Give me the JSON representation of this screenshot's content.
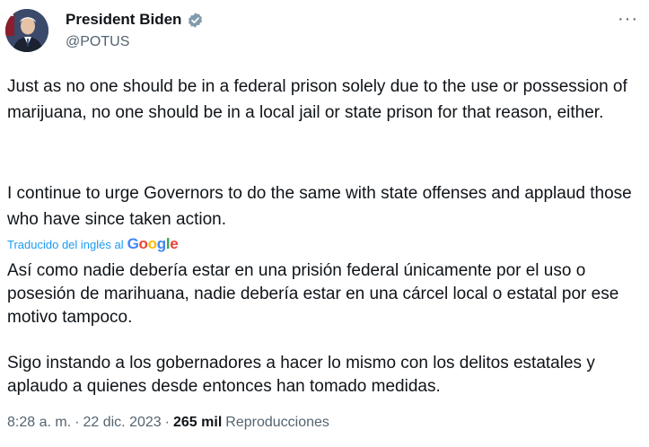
{
  "author": {
    "display_name": "President Biden",
    "handle": "@POTUS",
    "verified": true,
    "verified_color": "#829aab"
  },
  "menu": {
    "more_icon": "more-horizontal-icon",
    "label": "···"
  },
  "original": {
    "paragraph_1": "Just as no one should be in a federal prison solely due to the use or possession of marijuana, no one should be in a local jail or state prison for that reason, either.",
    "paragraph_2": "I continue to urge Governors to do the same with state offenses and applaud those who have since taken action."
  },
  "translation": {
    "label": "Traducido del inglés al",
    "provider": "Google",
    "paragraph_1": "Así como nadie debería estar en una prisión federal únicamente por el uso o posesión de marihuana, nadie debería estar en una cárcel local o estatal por ese motivo tampoco.",
    "paragraph_2": "Sigo instando a los gobernadores a hacer lo mismo con los delitos estatales y aplaudo a quienes desde entonces han tomado medidas."
  },
  "meta": {
    "time": "8:28 a. m.",
    "separator": "·",
    "date": "22 dic. 2023",
    "views_count": "265 mil",
    "views_label": "Reproducciones"
  },
  "colors": {
    "text": "#0f1419",
    "secondary": "#536471",
    "link": "#1d9bf0"
  }
}
